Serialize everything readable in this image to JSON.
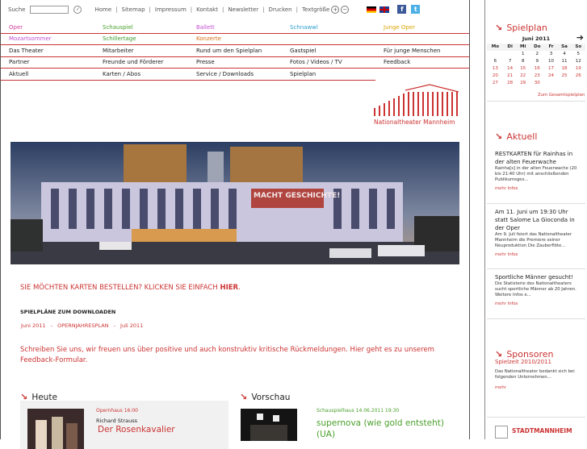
{
  "topbar": {
    "search_label": "Suche",
    "links": [
      "Home",
      "Sitemap",
      "Impressum",
      "Kontakt",
      "Newsletter",
      "Drucken",
      "Textgröße"
    ]
  },
  "nav": {
    "row1": [
      "Oper",
      "Schauspiel",
      "Ballett",
      "Schnawwl",
      "Junge Oper"
    ],
    "row1_colors": [
      "#d23c9a",
      "#4aa02c",
      "#c34fd0",
      "#2e9fd0",
      "#d9a400"
    ],
    "row2": [
      "Mozartsommer",
      "Schillertage",
      "Konzerte"
    ],
    "row2_colors": [
      "#c34fd0",
      "#3c9a2a",
      "#d86a10"
    ],
    "row3": [
      "Das Theater",
      "Mitarbeiter",
      "Rund um den Spielplan",
      "Gastspiel",
      "Für junge Menschen"
    ],
    "row4": [
      "Partner",
      "Freunde und Förderer",
      "Presse",
      "Fotos / Videos / TV",
      "Feedback"
    ],
    "row5": [
      "Aktuell",
      "Karten / Abos",
      "Service / Downloads",
      "Spielplan"
    ]
  },
  "logo": {
    "text": "Nationaltheater Mannheim"
  },
  "hero": {
    "banner": "MACHT GESCHICHTE!"
  },
  "cta": {
    "text": "SIE MÖCHTEN KARTEN BESTELLEN? KLICKEN SIE EINFACH",
    "link": "HIER",
    "tail": "."
  },
  "downloads": {
    "heading": "SPIELPLÄNE ZUM DOWNLOADEN",
    "links": [
      "Juni 2011",
      "OPERNJAHRESPLAN",
      "Juli 2011"
    ]
  },
  "feedback": {
    "text": "Schreiben Sie uns, wir freuen uns über positive und auch konstruktiv kritische Rückmeldungen. Hier geht es zu unserem Feedback-Formular."
  },
  "today": {
    "heading": "Heute",
    "venue": "Opernhaus 16:00",
    "composer": "Richard Strauss",
    "title": "Der Rosenkavalier"
  },
  "preview": {
    "heading": "Vorschau",
    "venue": "Schauspielhaus 14.06.2011 19:30",
    "title": "supernova (wie gold entsteht) (UA)"
  },
  "sidebar": {
    "spielplan_heading": "Spielplan",
    "calendar": {
      "month": "Juni 2011",
      "weekdays": [
        "Mo",
        "Di",
        "Mi",
        "Do",
        "Fr",
        "Sa",
        "So"
      ],
      "rows": [
        [
          "",
          "",
          "1",
          "2",
          "3",
          "4",
          "5"
        ],
        [
          "6",
          "7",
          "8",
          "9",
          "10",
          "11",
          "12"
        ],
        [
          "13",
          "14",
          "15",
          "16",
          "17",
          "18",
          "19"
        ],
        [
          "20",
          "21",
          "22",
          "23",
          "24",
          "25",
          "26"
        ],
        [
          "27",
          "28",
          "29",
          "30",
          "",
          "",
          ""
        ]
      ]
    },
    "full_plan_link": "Zum Gesamtspielplan",
    "aktuell_heading": "Aktuell",
    "news": [
      {
        "title": "RESTKARTEN für Rainhas in der alten Feuerwache",
        "body": "Rainha[s] in der alten Feuerwache (20 bis 21:40 Uhr) mit anschließenden Publikumsges...",
        "more": "mehr Infos"
      },
      {
        "title": "Am 11. Juni um 19:30 Uhr statt Salome La Gioconda in der Oper",
        "body": "Am 9. Juli feiert das Nationaltheater Mannheim die Premiere seiner Neuproduktion Die Zauberflöte...",
        "more": "mehr Infos"
      },
      {
        "title": "Sportliche Männer gesucht!",
        "body": "Die Statisterie des Nationaltheaters sucht sportliche Männer ab 20 Jahren. Weitere Infos e...",
        "more": "mehr Infos"
      }
    ],
    "sponsoren_heading": "Sponsoren",
    "sponsor_season": "Spielzeit 2010/2011",
    "sponsor_body": "Das Nationaltheater bedankt sich bei folgenden Unternehmen...",
    "sponsor_more": "mehr",
    "city_logo": "STADTMANNHEIM"
  }
}
